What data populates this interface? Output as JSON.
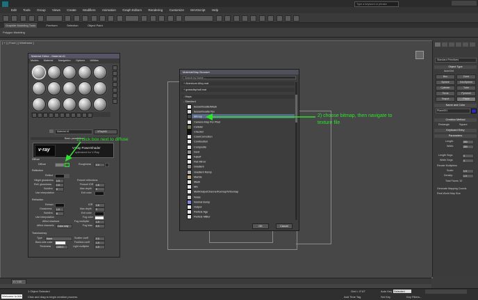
{
  "app": {
    "search_placeholder": "Type a keyword or phrase",
    "menus": [
      "Edit",
      "Tools",
      "Group",
      "Views",
      "Create",
      "Modifiers",
      "Animation",
      "Graph Editors",
      "Rendering",
      "Customize",
      "MAXScript",
      "Help"
    ]
  },
  "ribbon": {
    "tabs": [
      "Graphite Modeling Tools",
      "Freeform",
      "Selection",
      "Object Paint"
    ],
    "sub": "Polygon Modeling"
  },
  "viewport": {
    "label": "[ + ] [ Front ] [ Wireframe ]"
  },
  "material_editor": {
    "title": "Material Editor - Material #1",
    "menu": [
      "Modes",
      "Material",
      "Navigation",
      "Options",
      "Utilities"
    ],
    "material_name": "Material #1",
    "material_type": "VRayMtl",
    "rollout_title": "Basic parameters",
    "banner_line1": "V-Ray PowerShader",
    "banner_line2": "optimized for V-Ray",
    "banner_logo": "v·ray",
    "sections": {
      "diffuse": "Diffuse",
      "reflection": "Reflection",
      "refraction": "Refraction",
      "translucency": "Translucency"
    },
    "labels": {
      "diffuse": "Diffuse",
      "roughness": "Roughness",
      "roughness_val": "0.0",
      "reflect": "Reflect",
      "hilight_gloss": "Hilight glossiness",
      "hilight_gloss_val": "1.0",
      "fresnel": "Fresnel reflections",
      "refl_gloss": "Refl. glossiness",
      "refl_gloss_val": "1.0",
      "fresnel_ior": "Fresnel IOR",
      "fresnel_ior_val": "1.6",
      "subdivs": "Subdivs",
      "subdivs_val": "8",
      "max_depth": "Max depth",
      "max_depth_val": "5",
      "use_interp": "Use interpolation",
      "exit_color": "Exit color",
      "refract": "Refract",
      "ior": "IOR",
      "ior_val": "1.6",
      "glossiness": "Glossiness",
      "glossiness_val": "1.0",
      "refr_max_depth": "Max depth",
      "refr_max_depth_val": "5",
      "refr_subdivs": "Subdivs",
      "refr_subdivs_val": "8",
      "refr_exit_color": "Exit color",
      "refr_use_interp": "Use interpolation",
      "fog_color": "Fog color",
      "affect_shadows": "Affect shadows",
      "fog_multiplier": "Fog multiplier",
      "fog_multiplier_val": "1.0",
      "affect_channels": "Affect channels",
      "affect_channels_val": "Color only",
      "fog_bias": "Fog bias",
      "fog_bias_val": "0.0",
      "type": "Type",
      "type_val": "None",
      "backside_color": "Back-side color",
      "scatter_coeff": "Scatter coeff",
      "scatter_coeff_val": "0.0",
      "thickness": "Thickness",
      "thickness_val": "1000.0",
      "fwd_bck_coeff": "Fwd/bck coeff",
      "fwd_bck_coeff_val": "1.0",
      "light_multiplier": "Light multiplier",
      "light_multiplier_val": "1.0"
    }
  },
  "map_browser": {
    "title": "Material/Map Browser",
    "search_placeholder": "Search by Name ...",
    "groups": [
      "+ Aluminum Alloy.mat",
      "+ grassdisphalt.mat",
      "- Maps",
      "- Standard"
    ],
    "items": [
      "bessel/ScatterMask",
      "bessel/ScatterTex",
      "Bitmap",
      "Camera Map Per Pixel",
      "Cellular",
      "Checker",
      "ColorCorrection",
      "Combustion",
      "Composite",
      "Dent",
      "Falloff",
      "Flat Mirror",
      "Gradient",
      "Gradient Ramp",
      "Marble",
      "Mask",
      "Mix",
      "MultiOutputChannelTexmapToTexmap",
      "Noise",
      "Normal Bump",
      "Output",
      "Particle Age",
      "Particle MBlur"
    ],
    "selected_index": 2,
    "ok": "OK",
    "cancel": "Cancel"
  },
  "annotations": {
    "step1": "1) click box next to diffuse",
    "step2_line1": "2) choose bitmap, then navigate to",
    "step2_line2": "texture file"
  },
  "command_panel": {
    "dropdown": "Standard Primitives",
    "object_type": "Object Type",
    "autogrid": "AutoGrid",
    "buttons": [
      "Box",
      "Cone",
      "Sphere",
      "GeoSphere",
      "Cylinder",
      "Tube",
      "Torus",
      "Pyramid",
      "Teapot",
      "Plane"
    ],
    "name_and_color": "Name and Color",
    "object_name": "Plane001",
    "creation_method": "Creation Method",
    "rectangle": "Rectangle",
    "square": "Square",
    "keyboard_entry": "Keyboard Entry",
    "parameters": "Parameters",
    "length": "Length:",
    "length_val": "350",
    "width": "Width:",
    "width_val": "350",
    "length_segs": "Length Segs:",
    "length_segs_val": "4",
    "width_segs": "Width Segs:",
    "width_segs_val": "4",
    "render_multipliers": "Render Multipliers",
    "scale": "Scale:",
    "scale_val": "1.0",
    "density": "Density:",
    "density_val": "1.0",
    "total_faces": "Total Faces: 32",
    "gen_mapping": "Generate Mapping Coords.",
    "real_world": "Real-World Map Size"
  },
  "status": {
    "frame": "0 / 100",
    "selected": "1 Object Selected",
    "hint": "Click and drag to begin creation process",
    "welcome": "Welcome to MA",
    "autokey": "Auto Key",
    "selected_dd": "Selected",
    "setkey": "Set Key",
    "keyfilters": "Key Filters...",
    "add_time_tag": "Add Time Tag",
    "grid": "Grid = 0'10\""
  }
}
